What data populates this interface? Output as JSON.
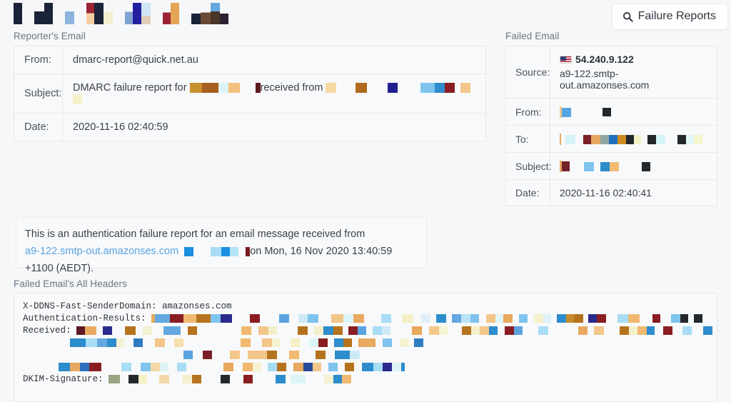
{
  "theme": {
    "page_bg": "#f6f7f8",
    "panel_bg": "#f8f9fa",
    "border": "#e6e8ea",
    "label_color": "#6b7585",
    "link_color": "#5ba3e0"
  },
  "header": {
    "failure_reports_button": "Failure Reports",
    "search_icon": "search-icon",
    "nav_redactions": [
      [
        {
          "c": "#1b2338",
          "w": 12
        }
      ],
      [
        {
          "c": "#f6f7f8",
          "w": 7
        },
        {
          "c": "#1b2338",
          "w": 7
        },
        {
          "c": "#f6f7f8",
          "w": 0
        }
      ],
      [
        {
          "c": "#8cb4dd",
          "w": 10
        }
      ],
      [
        {
          "c": "#9c2335",
          "w": 9
        },
        {
          "c": "#1b2338",
          "w": 11
        },
        {
          "c": "#f6f7f8",
          "w": 2
        }
      ],
      [
        {
          "c": "#7fa3cf",
          "w": 9
        },
        {
          "c": "#2320a0",
          "w": 11
        },
        {
          "c": "#cfe6f5",
          "w": 10
        }
      ],
      [
        {
          "c": "#9c2335",
          "w": 10
        },
        {
          "c": "#e3a košt",
          "w": 0
        }
      ],
      [
        {
          "c": "#1b2338",
          "w": 10
        },
        {
          "c": "#6b4a35",
          "w": 11
        },
        {
          "c": "#4a3528",
          "w": 10
        },
        {
          "c": "#2c2030",
          "w": 9
        }
      ]
    ]
  },
  "reporter": {
    "section_label": "Reporter's Email",
    "rows": [
      {
        "key": "From:",
        "value": "dmarc-report@quick.net.au",
        "redacted": false
      },
      {
        "key": "Subject:",
        "value": "DMARC failure report for ",
        "value2": "received from ",
        "redacted": true
      },
      {
        "key": "Date:",
        "value": "2020-11-16 02:40:59",
        "redacted": false
      }
    ]
  },
  "failed": {
    "section_label": "Failed Email",
    "source_flag": "us-flag-icon",
    "source_ip": "54.240.9.122",
    "source_host": "a9-122.smtp-out.amazonses.com",
    "rows": [
      {
        "key": "Source:"
      },
      {
        "key": "From:"
      },
      {
        "key": "To:"
      },
      {
        "key": "Subject:"
      },
      {
        "key": "Date:",
        "value": "2020-11-16 02:40:41"
      }
    ]
  },
  "info": {
    "line1": "This is an authentication failure report for an email message received from",
    "link": "a9-122.smtp-out.amazonses.com",
    "tail": "on Mon, 16 Nov 2020 13:40:59 +1100 (AEDT)."
  },
  "headers": {
    "section_label": "Failed Email's All Headers",
    "line_sender_domain": "X-DDNS-Fast-SenderDomain: amazonses.com",
    "line_auth_results": "Authentication-Results:",
    "line_received": "Received:",
    "line_dkim": "DKIM-Signature:"
  }
}
